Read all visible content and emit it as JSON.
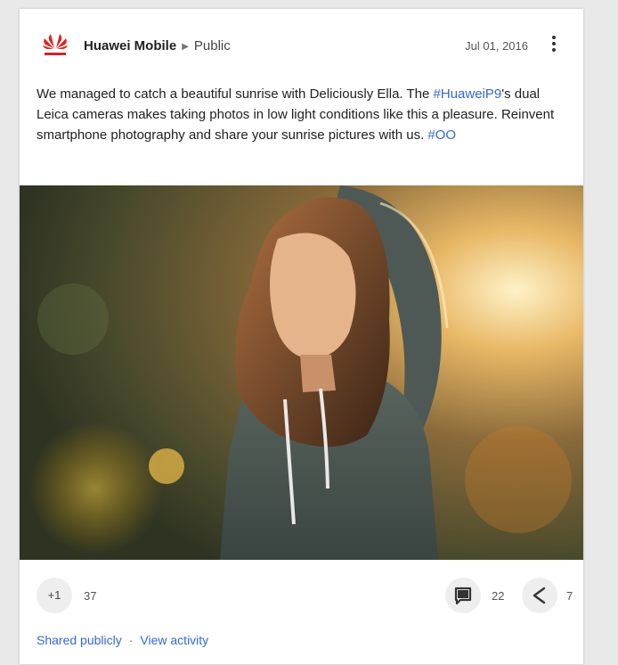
{
  "post": {
    "author": "Huawei Mobile",
    "visibility": "Public",
    "date": "Jul 01, 2016",
    "text_part1": "We managed to catch a beautiful sunrise with Deliciously Ella. The ",
    "hashtag1": "#HuaweiP9",
    "text_part2": "'s dual Leica cameras makes taking photos in low light conditions like this a pleasure. Reinvent smartphone photography and share your sunrise pictures with us. ",
    "hashtag2": "#OO"
  },
  "actions": {
    "plusone_label": "+1",
    "plusone_count": "37",
    "comment_count": "22",
    "share_count": "7"
  },
  "footer": {
    "shared_label": "Shared publicly",
    "separator": "·",
    "activity_label": "View activity"
  },
  "colors": {
    "link": "#3367d6",
    "brand_red": "#e2231a"
  },
  "icons": [
    "huawei-logo",
    "more-vert-icon",
    "comment-icon",
    "share-icon"
  ]
}
